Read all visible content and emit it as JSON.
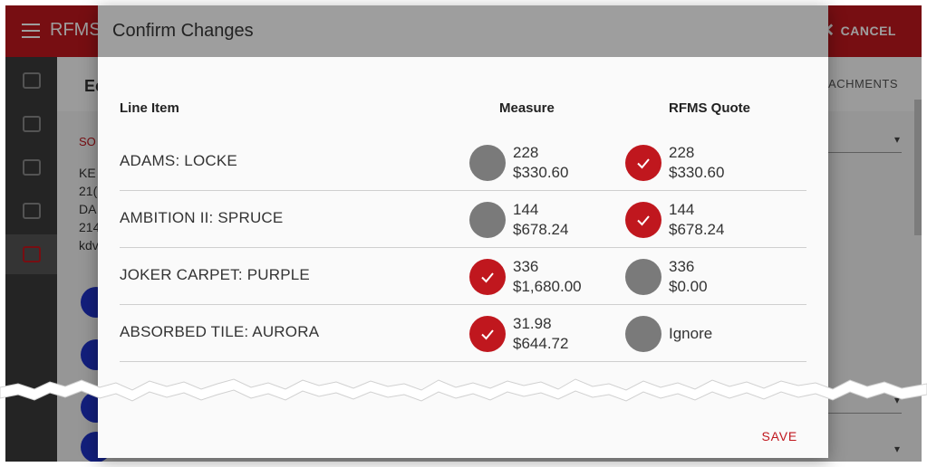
{
  "app": {
    "brand": "RFMS",
    "cancel_label": "CANCEL",
    "page_title": "Ec",
    "attachments_tab": "ACHMENTS",
    "section_label": "SO",
    "address_lines": [
      "KE",
      "21(",
      "DA",
      "214",
      "kdv"
    ]
  },
  "dialog": {
    "title": "Confirm Changes",
    "columns": {
      "line_item": "Line Item",
      "measure": "Measure",
      "quote": "RFMS Quote"
    },
    "rows": [
      {
        "name": "ADAMS: LOCKE",
        "measure": {
          "checked": false,
          "qty": "228",
          "price": "$330.60"
        },
        "quote": {
          "checked": true,
          "qty": "228",
          "price": "$330.60"
        }
      },
      {
        "name": "AMBITION II: SPRUCE",
        "measure": {
          "checked": false,
          "qty": "144",
          "price": "$678.24"
        },
        "quote": {
          "checked": true,
          "qty": "144",
          "price": "$678.24"
        }
      },
      {
        "name": "JOKER CARPET: PURPLE",
        "measure": {
          "checked": true,
          "qty": "336",
          "price": "$1,680.00"
        },
        "quote": {
          "checked": false,
          "qty": "336",
          "price": "$0.00"
        }
      },
      {
        "name": "ABSORBED TILE: AURORA",
        "measure": {
          "checked": true,
          "qty": "31.98",
          "price": "$644.72"
        },
        "quote": {
          "checked": false,
          "qty": "Ignore",
          "price": ""
        }
      }
    ],
    "save_label": "SAVE"
  },
  "colors": {
    "brand_red": "#c0171e",
    "unchecked_gray": "#7a7a7a",
    "header_gray": "#9e9e9e",
    "nav_blue": "#2032c8"
  },
  "icons": {
    "menu": "hamburger-icon",
    "cancel": "close-icon",
    "check": "checkmark-icon"
  }
}
